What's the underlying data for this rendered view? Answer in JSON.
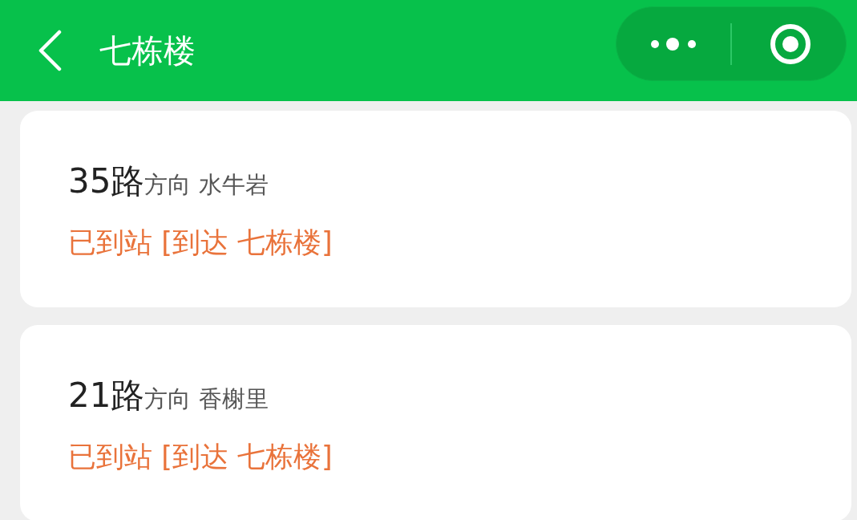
{
  "header": {
    "title": "七栋楼"
  },
  "routes": [
    {
      "route": "35路",
      "direction_label": "方向",
      "destination": "水牛岩",
      "status": "已到站 [到达 七栋楼]"
    },
    {
      "route": "21路",
      "direction_label": "方向",
      "destination": "香榭里",
      "status": "已到站 [到达 七栋楼]"
    }
  ]
}
